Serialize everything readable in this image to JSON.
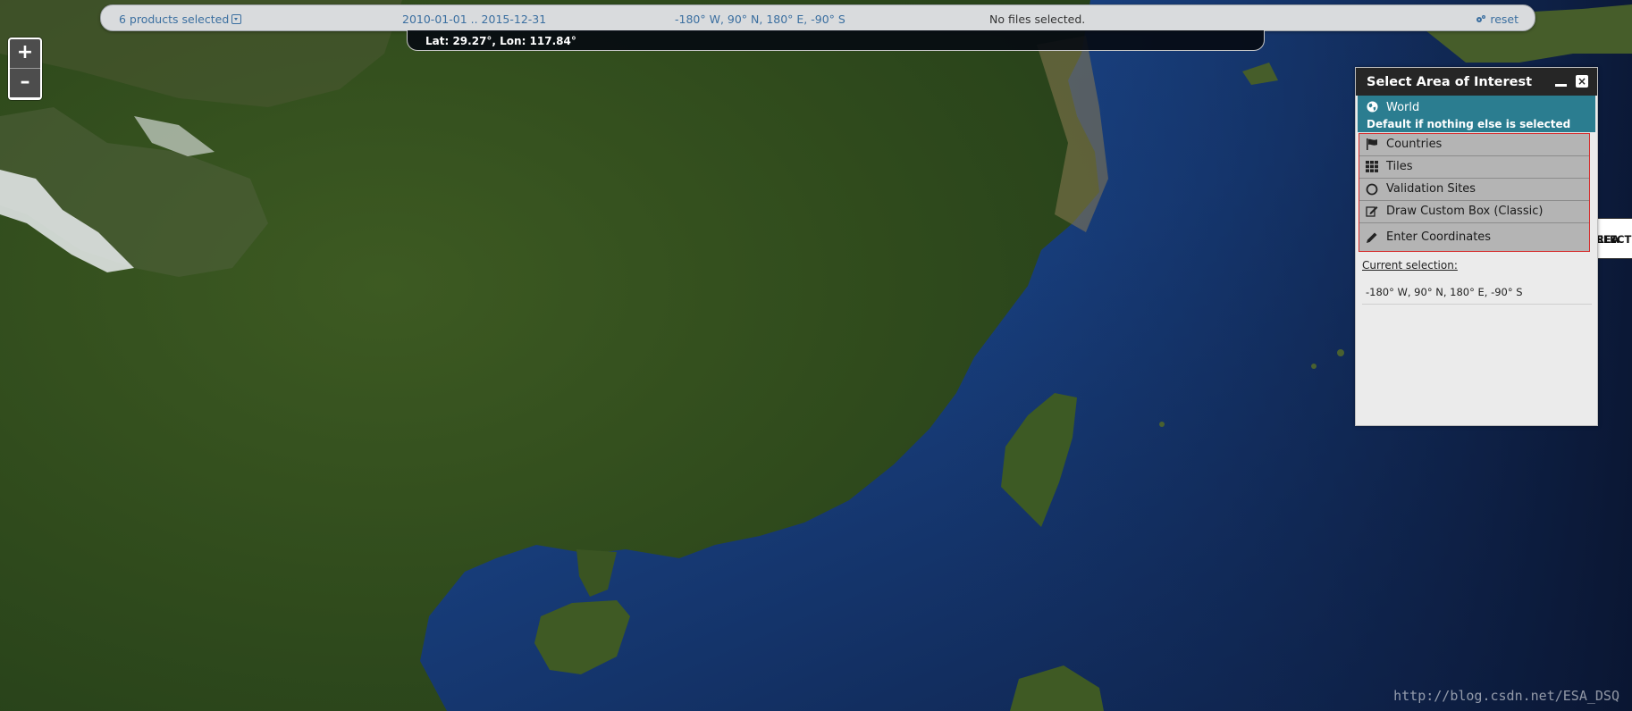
{
  "topbar": {
    "products": "6 products selected",
    "dates": "2010-01-01 .. 2015-12-31",
    "bbox": "-180° W, 90° N, 180° E, -90° S",
    "files": "No files selected.",
    "reset": "reset"
  },
  "cursor_coords": "Lat: 29.27°, Lon: 117.84°",
  "zoom": {
    "in": "+",
    "out": "–"
  },
  "side_tab": {
    "line1": "ELECT",
    "line2": "REA"
  },
  "panel": {
    "title": "Select Area of Interest",
    "close": "×",
    "world": {
      "label": "World",
      "sub": "Default if nothing else is selected",
      "icon": "globe-icon"
    },
    "options": [
      {
        "label": "Countries",
        "icon": "flag-icon"
      },
      {
        "label": "Tiles",
        "icon": "grid-icon"
      },
      {
        "label": "Validation Sites",
        "icon": "circle-icon"
      },
      {
        "label": "Draw Custom Box (Classic)",
        "icon": "edit-icon"
      },
      {
        "label": "Enter Coordinates",
        "icon": "pencil-icon"
      }
    ],
    "current_label": "Current selection:",
    "current_value": "-180° W, 90° N, 180° E, -90° S"
  },
  "watermark": "http://blog.csdn.net/ESA_DSQ",
  "colors": {
    "accent": "#2b7d90",
    "link": "#3b6fa0",
    "header": "#262626",
    "option_bg": "#b4b4b4"
  }
}
